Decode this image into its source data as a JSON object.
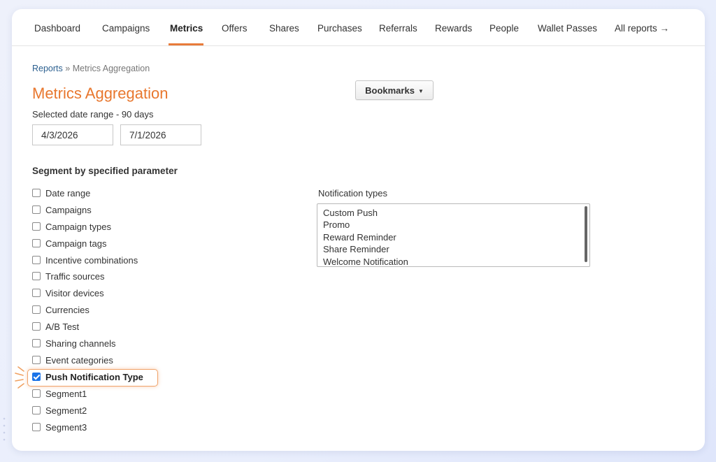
{
  "nav": {
    "items": [
      {
        "label": "Dashboard",
        "active": false
      },
      {
        "label": "Campaigns",
        "active": false
      },
      {
        "label": "Metrics",
        "active": true
      },
      {
        "label": "Offers",
        "active": false
      },
      {
        "label": "Shares",
        "active": false
      },
      {
        "label": "Purchases",
        "active": false
      },
      {
        "label": "Referrals",
        "active": false
      },
      {
        "label": "Rewards",
        "active": false
      },
      {
        "label": "People",
        "active": false
      },
      {
        "label": "Wallet Passes",
        "active": false
      },
      {
        "label": "All reports →",
        "active": false
      }
    ],
    "accent_color": "#e87b3a"
  },
  "breadcrumb": {
    "root": "Reports",
    "separator": "»",
    "current": "Metrics Aggregation"
  },
  "page": {
    "title": "Metrics Aggregation",
    "title_color": "#e8772e"
  },
  "date_range": {
    "label": "Selected date range - 90 days",
    "start": "4/3/2026",
    "end": "7/1/2026"
  },
  "bookmarks": {
    "label": "Bookmarks",
    "caret_icon": "caret-down-icon"
  },
  "segment": {
    "title": "Segment by specified parameter",
    "options": [
      {
        "label": "Date range",
        "checked": false
      },
      {
        "label": "Campaigns",
        "checked": false
      },
      {
        "label": "Campaign types",
        "checked": false
      },
      {
        "label": "Campaign tags",
        "checked": false
      },
      {
        "label": "Incentive combinations",
        "checked": false
      },
      {
        "label": "Traffic sources",
        "checked": false
      },
      {
        "label": "Visitor devices",
        "checked": false
      },
      {
        "label": "Currencies",
        "checked": false
      },
      {
        "label": "A/B Test",
        "checked": false
      },
      {
        "label": "Sharing channels",
        "checked": false
      },
      {
        "label": "Event categories",
        "checked": false
      },
      {
        "label": "Push Notification Type",
        "checked": true
      },
      {
        "label": "Segment1",
        "checked": false
      },
      {
        "label": "Segment2",
        "checked": false
      },
      {
        "label": "Segment3",
        "checked": false
      }
    ]
  },
  "notification_types": {
    "label": "Notification types",
    "options": [
      "Custom Push",
      "Promo",
      "Reward Reminder",
      "Share Reminder",
      "Welcome Notification"
    ]
  }
}
